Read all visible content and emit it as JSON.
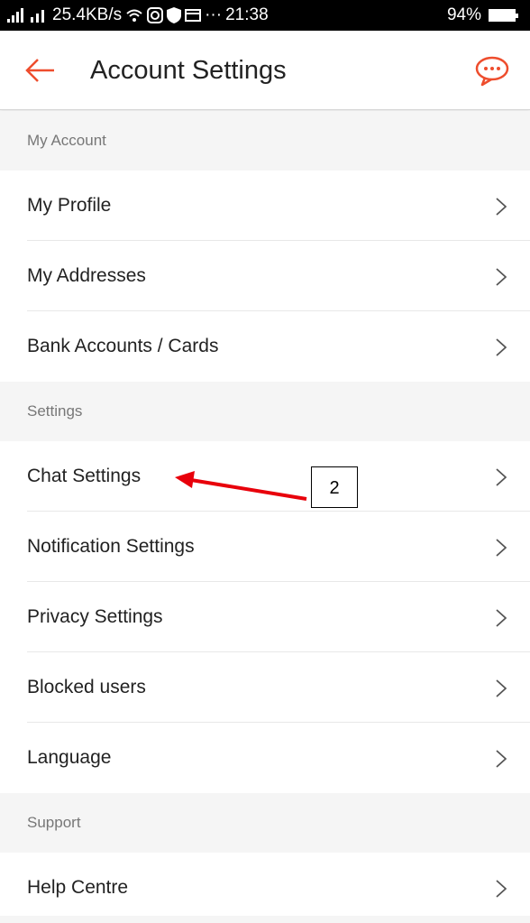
{
  "status_bar": {
    "left_text": "25.4KB/s",
    "dots": "···",
    "time": "21:38",
    "battery": "94%"
  },
  "header": {
    "title": "Account Settings",
    "back_icon": "arrow-left-icon",
    "chat_icon": "chat-bubble-icon"
  },
  "sections": {
    "my_account": {
      "title": "My Account",
      "items": [
        "My Profile",
        "My Addresses",
        "Bank Accounts / Cards"
      ]
    },
    "settings": {
      "title": "Settings",
      "items": [
        "Chat Settings",
        "Notification Settings",
        "Privacy Settings",
        "Blocked users",
        "Language"
      ]
    },
    "support": {
      "title": "Support",
      "items": [
        "Help Centre"
      ]
    }
  },
  "annotation": {
    "label": "2"
  },
  "colors": {
    "accent": "#ee4d2d",
    "annotation_arrow": "#e8000b"
  }
}
